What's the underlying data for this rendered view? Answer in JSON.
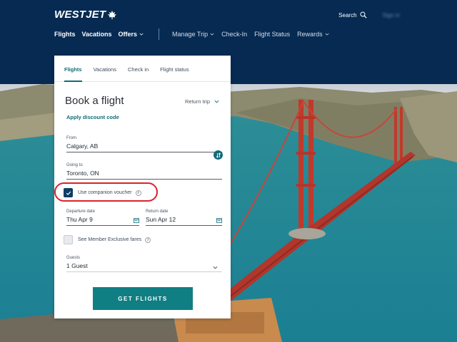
{
  "header": {
    "logo": "WESTJET",
    "search_label": "Search",
    "signin_label": "Sign in",
    "nav_primary": [
      {
        "label": "Flights",
        "chevron": false
      },
      {
        "label": "Vacations",
        "chevron": false
      },
      {
        "label": "Offers",
        "chevron": true
      }
    ],
    "nav_secondary": [
      {
        "label": "Manage Trip",
        "chevron": true
      },
      {
        "label": "Check-In",
        "chevron": false
      },
      {
        "label": "Flight Status",
        "chevron": false
      },
      {
        "label": "Rewards",
        "chevron": true
      }
    ]
  },
  "booking": {
    "tabs": [
      "Flights",
      "Vacations",
      "Check in",
      "Flight status"
    ],
    "active_tab": 0,
    "title": "Book a flight",
    "trip_type": "Return trip",
    "discount_link": "Apply discount code",
    "from": {
      "label": "From",
      "value": "Calgary, AB"
    },
    "to": {
      "label": "Going to",
      "value": "Toronto, ON"
    },
    "companion": {
      "label": "Use companion voucher",
      "checked": true
    },
    "departure": {
      "label": "Departure date",
      "value": "Thu Apr 9"
    },
    "return": {
      "label": "Return date",
      "value": "Sun Apr 12"
    },
    "member_fares": {
      "label": "See Member Exclusive fares",
      "checked": false
    },
    "guests": {
      "label": "Guests",
      "value": "1 Guest"
    },
    "cta": "GET FLIGHTS"
  },
  "colors": {
    "header_bg": "#062a52",
    "accent": "#0f6b78",
    "cta": "#0f7f83",
    "highlight": "#d8242a",
    "checkbox": "#0e3d66"
  },
  "icons": [
    "maple-leaf-icon",
    "search-icon",
    "chevron-down-icon",
    "swap-icon",
    "check-icon",
    "info-icon",
    "calendar-icon"
  ]
}
